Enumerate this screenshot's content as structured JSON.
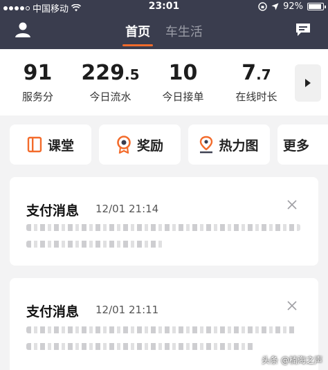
{
  "status_bar": {
    "carrier": "中国移动",
    "time": "23:01",
    "battery": "92%"
  },
  "header": {
    "tabs": [
      {
        "label": "首页",
        "active": true
      },
      {
        "label": "车生活",
        "active": false
      }
    ]
  },
  "stats": [
    {
      "value": "91",
      "decimal": "",
      "label": "服务分"
    },
    {
      "value": "229",
      "decimal": ".5",
      "label": "今日流水"
    },
    {
      "value": "10",
      "decimal": "",
      "label": "今日接单"
    },
    {
      "value": "7",
      "decimal": ".7",
      "label": "在线时长"
    }
  ],
  "shortcuts": [
    {
      "label": "课堂",
      "icon": "book-icon"
    },
    {
      "label": "奖励",
      "icon": "medal-icon"
    },
    {
      "label": "热力图",
      "icon": "map-pin-icon"
    },
    {
      "label": "更多",
      "icon": ""
    }
  ],
  "messages": [
    {
      "title": "支付消息",
      "time": "12/01 21:14"
    },
    {
      "title": "支付消息",
      "time": "12/01 21:11"
    }
  ],
  "watermark": "头条 @楠海之声",
  "colors": {
    "header_bg": "#3a3d4e",
    "accent": "#f36b2b",
    "page_bg": "#f3f3f4"
  }
}
